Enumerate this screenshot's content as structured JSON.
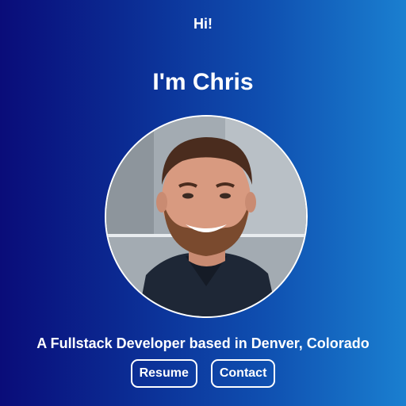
{
  "hero": {
    "greeting": "Hi!",
    "name": "I'm Chris",
    "tagline": "A Fullstack Developer based in Denver, Colorado"
  },
  "buttons": {
    "resume_label": "Resume",
    "contact_label": "Contact"
  },
  "colors": {
    "gradient_start": "#0a0c79",
    "gradient_end": "#1a7fd0",
    "text": "#ffffff"
  }
}
